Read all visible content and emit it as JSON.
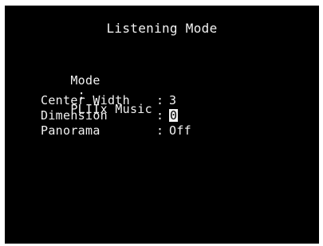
{
  "screen": {
    "title": "Listening Mode",
    "mode_label": "Mode",
    "mode_sep": ":",
    "mode_value": "PLIIx Music",
    "settings": [
      {
        "label": "Center Width",
        "sep": ":",
        "value": "3"
      },
      {
        "label": "Dimension",
        "sep": ":",
        "value": "0"
      },
      {
        "label": "Panorama",
        "sep": ":",
        "value": "Off"
      }
    ],
    "selected_index": 1
  },
  "colors": {
    "background": "#000000",
    "text": "#f2f2f2",
    "highlight": "#f2f2f2"
  }
}
